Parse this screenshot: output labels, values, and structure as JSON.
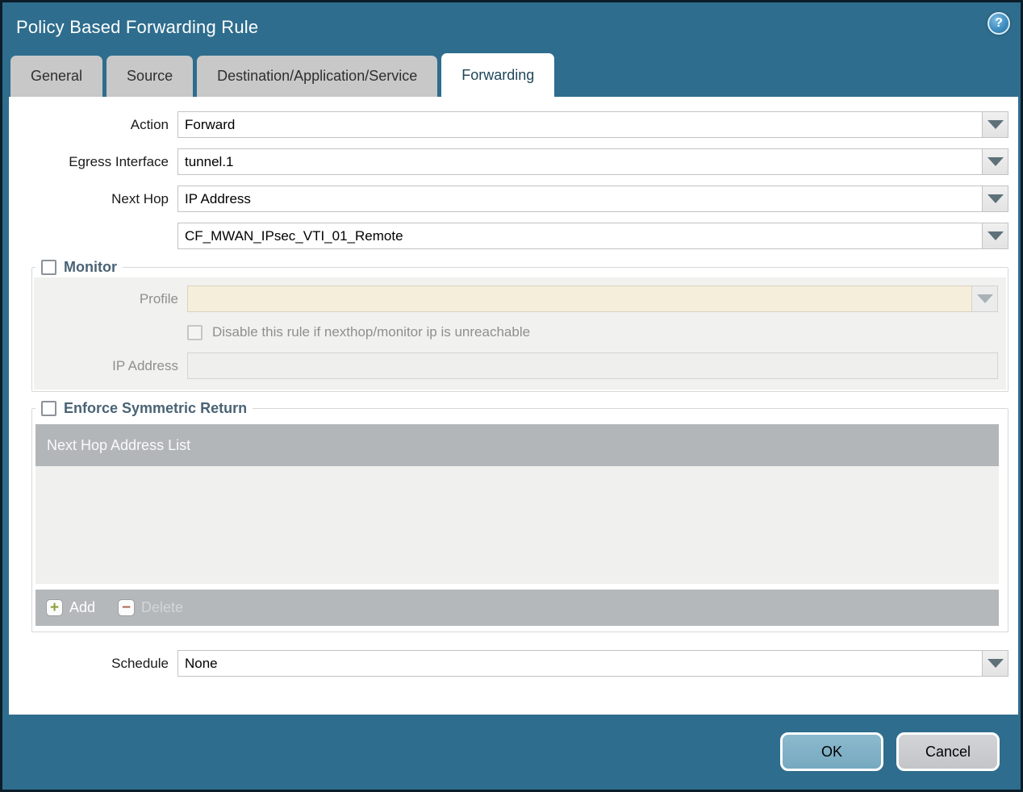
{
  "dialog": {
    "title": "Policy Based Forwarding Rule",
    "help_glyph": "?"
  },
  "tabs": [
    {
      "label": "General",
      "active": false
    },
    {
      "label": "Source",
      "active": false
    },
    {
      "label": "Destination/Application/Service",
      "active": false
    },
    {
      "label": "Forwarding",
      "active": true
    }
  ],
  "form": {
    "action_label": "Action",
    "action_value": "Forward",
    "egress_label": "Egress Interface",
    "egress_value": "tunnel.1",
    "next_hop_label": "Next Hop",
    "next_hop_value": "IP Address",
    "next_hop_address_value": "CF_MWAN_IPsec_VTI_01_Remote",
    "schedule_label": "Schedule",
    "schedule_value": "None"
  },
  "monitor": {
    "title": "Monitor",
    "checked": false,
    "profile_label": "Profile",
    "profile_value": "",
    "disable_checkbox_label": "Disable this rule if nexthop/monitor ip is unreachable",
    "disable_checkbox_checked": false,
    "ip_address_label": "IP Address",
    "ip_address_value": ""
  },
  "symmetric_return": {
    "title": "Enforce Symmetric Return",
    "checked": false,
    "list_header": "Next Hop Address List",
    "list_rows": [],
    "add_label": "Add",
    "add_glyph": "+",
    "delete_label": "Delete",
    "delete_glyph": "−",
    "delete_enabled": false
  },
  "buttons": {
    "ok": "OK",
    "cancel": "Cancel"
  },
  "colors": {
    "titlebar_teal": "#2e6d8d",
    "outer_border": "#0b1d28",
    "inactive_tab": "#c8c8c8",
    "active_tab_text": "#20465a",
    "section_title": "#4a6375",
    "table_header": "#b2b6b9",
    "table_body": "#f0f0ee",
    "profile_disabled_bg": "#f5eeda",
    "ok_button": "#7fb1c7",
    "cancel_button": "#c9cbce",
    "add_plus_green": "#8ba33e",
    "delete_minus_red": "#b06a55"
  }
}
